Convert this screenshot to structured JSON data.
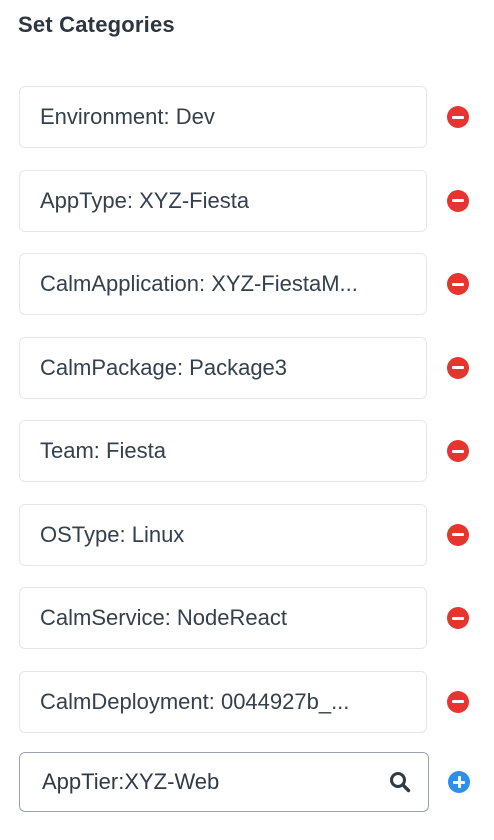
{
  "panel": {
    "title": "Set Categories"
  },
  "categories": [
    {
      "label": "Environment: Dev"
    },
    {
      "label": "AppType: XYZ-Fiesta"
    },
    {
      "label": "CalmApplication: XYZ-FiestaM..."
    },
    {
      "label": "CalmPackage: Package3"
    },
    {
      "label": "Team: Fiesta"
    },
    {
      "label": "OSType: Linux"
    },
    {
      "label": "CalmService: NodeReact"
    },
    {
      "label": "CalmDeployment: 0044927b_..."
    }
  ],
  "new_category": {
    "value": "AppTier:XYZ-Web"
  },
  "colors": {
    "remove": "#e6352f",
    "add": "#2f8fe6",
    "text": "#34404c"
  },
  "icons": {
    "remove": "minus-circle-icon",
    "add": "plus-circle-icon",
    "search": "search-icon"
  }
}
